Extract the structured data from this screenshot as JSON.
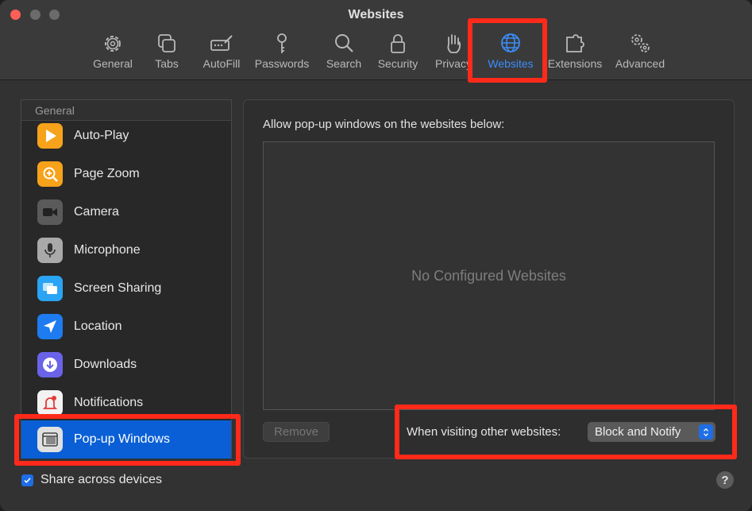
{
  "window": {
    "title": "Websites"
  },
  "toolbar": {
    "tabs": [
      {
        "label": "General",
        "icon": "gear-icon"
      },
      {
        "label": "Tabs",
        "icon": "tabs-icon"
      },
      {
        "label": "AutoFill",
        "icon": "autofill-icon"
      },
      {
        "label": "Passwords",
        "icon": "key-icon"
      },
      {
        "label": "Search",
        "icon": "search-icon"
      },
      {
        "label": "Security",
        "icon": "lock-icon"
      },
      {
        "label": "Privacy",
        "icon": "hand-icon"
      },
      {
        "label": "Websites",
        "icon": "globe-icon",
        "active": true
      },
      {
        "label": "Extensions",
        "icon": "puzzle-icon"
      },
      {
        "label": "Advanced",
        "icon": "gears-icon"
      }
    ]
  },
  "sidebar": {
    "header": "General",
    "items": [
      {
        "label": "Auto-Play",
        "icon": "play-icon",
        "color": "#f7a21b"
      },
      {
        "label": "Page Zoom",
        "icon": "zoom-icon",
        "color": "#f7a21b"
      },
      {
        "label": "Camera",
        "icon": "camera-icon",
        "color": "#5a5a5a"
      },
      {
        "label": "Microphone",
        "icon": "microphone-icon",
        "color": "#a9a9a9"
      },
      {
        "label": "Screen Sharing",
        "icon": "screen-sharing-icon",
        "color": "#2aa4f4"
      },
      {
        "label": "Location",
        "icon": "location-icon",
        "color": "#1e7bf0"
      },
      {
        "label": "Downloads",
        "icon": "download-icon",
        "color": "#6a63e8"
      },
      {
        "label": "Notifications",
        "icon": "notification-icon",
        "color": "#f2f2f2"
      },
      {
        "label": "Pop-up Windows",
        "icon": "popup-window-icon",
        "color": "#e0e0e0",
        "selected": true
      }
    ]
  },
  "main": {
    "caption": "Allow pop-up windows on the websites below:",
    "empty_text": "No Configured Websites",
    "remove_label": "Remove",
    "visiting_label": "When visiting other websites:",
    "select_value": "Block and Notify"
  },
  "footer": {
    "share_label": "Share across devices",
    "share_checked": true,
    "help_label": "?"
  },
  "colors": {
    "accent": "#1e6ee6",
    "highlight": "#ff2a1a"
  }
}
